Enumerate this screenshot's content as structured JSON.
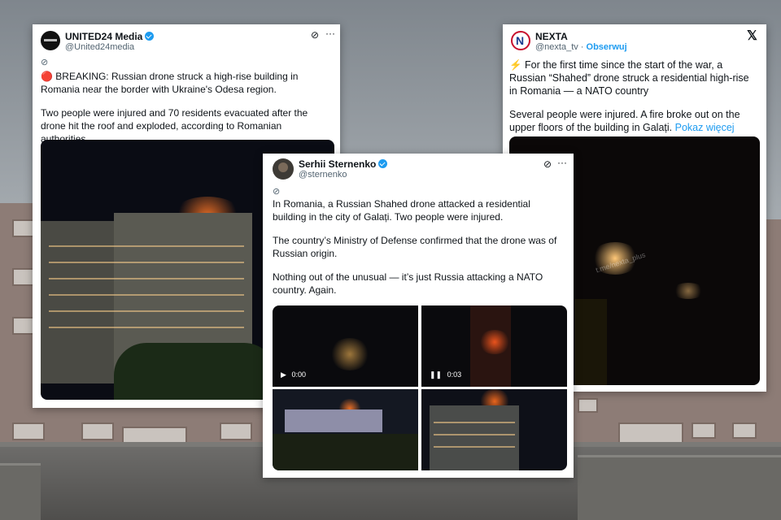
{
  "tweets": [
    {
      "name": "UNITED24 Media",
      "handle": "@United24media",
      "paragraphs": [
        "🔴 BREAKING: Russian drone struck a high-rise building in Romania near the border with Ukraine's Odesa region.",
        "Two people were injured and 70 residents evacuated after the drone hit the roof and exploded, according to Romanian authorities."
      ]
    },
    {
      "name": "NEXTA",
      "handle": "@nexta_tv",
      "follow_label": "Obserwuj",
      "paragraphs": [
        "⚡ For the first time since the start of the war, a Russian “Shahed” drone struck a residential high-rise in Romania — a NATO country",
        "Several people were injured. A fire broke out on the upper floors of the building in Galați."
      ],
      "show_more": "Pokaz więcej",
      "watermark": "t.me/nexta_plus"
    },
    {
      "name": "Serhii Sternenko",
      "handle": "@sternenko",
      "paragraphs": [
        "In Romania, a Russian Shahed drone attacked a residential building in the city of Galați. Two people were injured.",
        "The country’s Ministry of Defense confirmed that the drone was of Russian origin.",
        "Nothing out of the unusual — it’s just Russia attacking a NATO country. Again."
      ],
      "videos": [
        {
          "time": "0:00",
          "control": "play"
        },
        {
          "time": "0:03",
          "control": "pause"
        }
      ]
    }
  ],
  "icons": {
    "verified": "verified-badge-icon",
    "grok": "grok-icon",
    "more": "more-options-icon",
    "close": "x-logo-icon"
  },
  "colors": {
    "accent": "#1d9bf0",
    "breaking": "#e0245e"
  }
}
